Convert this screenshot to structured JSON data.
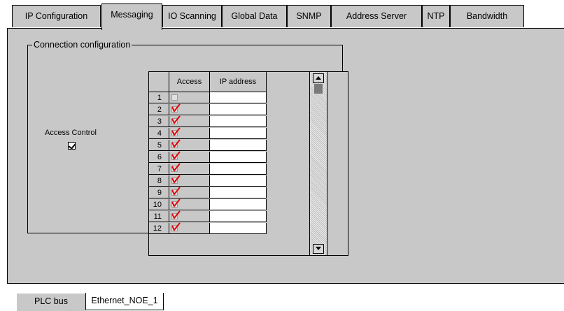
{
  "tabs": [
    {
      "label": "IP Configuration",
      "active": false
    },
    {
      "label": "Messaging",
      "active": true
    },
    {
      "label": "IO Scanning",
      "active": false
    },
    {
      "label": "Global Data",
      "active": false
    },
    {
      "label": "SNMP",
      "active": false
    },
    {
      "label": "Address Server",
      "active": false
    },
    {
      "label": "NTP",
      "active": false
    },
    {
      "label": "Bandwidth",
      "active": false
    }
  ],
  "group": {
    "title": "Connection configuration"
  },
  "access_control": {
    "label": "Access Control",
    "checked": true
  },
  "table": {
    "columns": [
      "Access",
      "IP address"
    ],
    "rows": [
      {
        "num": "1",
        "access": false,
        "ip": ""
      },
      {
        "num": "2",
        "access": true,
        "ip": ""
      },
      {
        "num": "3",
        "access": true,
        "ip": ""
      },
      {
        "num": "4",
        "access": true,
        "ip": ""
      },
      {
        "num": "5",
        "access": true,
        "ip": ""
      },
      {
        "num": "6",
        "access": true,
        "ip": ""
      },
      {
        "num": "7",
        "access": true,
        "ip": ""
      },
      {
        "num": "8",
        "access": true,
        "ip": ""
      },
      {
        "num": "9",
        "access": true,
        "ip": ""
      },
      {
        "num": "10",
        "access": true,
        "ip": ""
      },
      {
        "num": "11",
        "access": true,
        "ip": ""
      },
      {
        "num": "12",
        "access": true,
        "ip": ""
      }
    ]
  },
  "scrollbar": {
    "up_icon": "arrow-up-icon",
    "down_icon": "arrow-down-icon"
  },
  "bottom_tabs": [
    {
      "label": "PLC bus",
      "active": false
    },
    {
      "label": "Ethernet_NOE_1",
      "active": true
    }
  ],
  "colors": {
    "panel": "#c8c8c8",
    "tick": "#e00000"
  }
}
